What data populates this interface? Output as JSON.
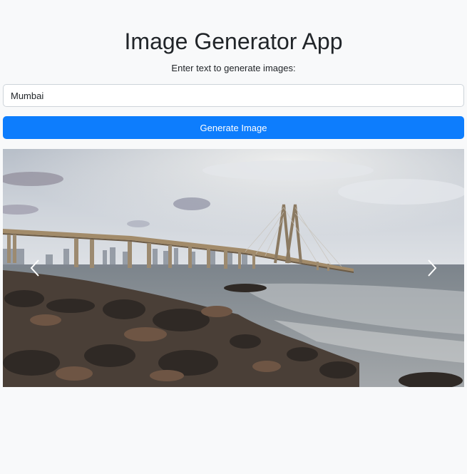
{
  "app": {
    "title": "Image Generator App",
    "subtitle": "Enter text to generate images:"
  },
  "form": {
    "input_value": "Mumbai",
    "button_label": "Generate Image"
  },
  "carousel": {
    "image_subject": "sea-link bridge over rocky shoreline",
    "prev_icon": "chevron-left-icon",
    "next_icon": "chevron-right-icon"
  },
  "colors": {
    "background": "#f8f9fa",
    "primary": "#0d7dfd",
    "text": "#212529"
  }
}
